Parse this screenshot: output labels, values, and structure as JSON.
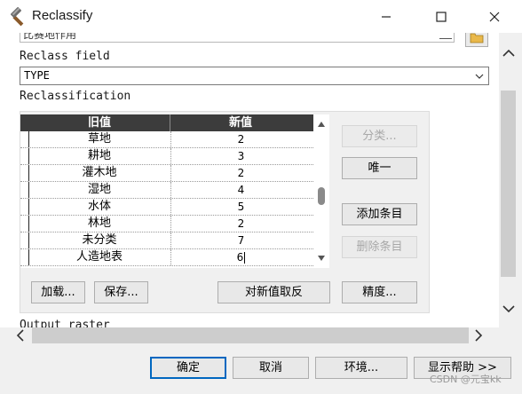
{
  "window": {
    "title": "Reclassify",
    "minimize_icon": "minimize-icon",
    "maximize_icon": "maximize-icon",
    "close_icon": "close-icon"
  },
  "input_raster": {
    "value": "比赛地作用"
  },
  "reclass_field": {
    "label": "Reclass field",
    "value": "TYPE"
  },
  "reclassification": {
    "label": "Reclassification",
    "headers": {
      "old": "旧值",
      "new": "新值"
    },
    "rows": [
      {
        "old": "草地",
        "new": "2"
      },
      {
        "old": "耕地",
        "new": "3"
      },
      {
        "old": "灌木地",
        "new": "2"
      },
      {
        "old": "湿地",
        "new": "4"
      },
      {
        "old": "水体",
        "new": "5"
      },
      {
        "old": "林地",
        "new": "2"
      },
      {
        "old": "未分类",
        "new": "7"
      },
      {
        "old": "人造地表",
        "new": "6"
      }
    ],
    "buttons": {
      "classify": "分类...",
      "unique": "唯一",
      "add_entry": "添加条目",
      "delete_entry": "删除条目",
      "load": "加载...",
      "save": "保存...",
      "reverse": "对新值取反",
      "precision": "精度..."
    }
  },
  "output_raster": {
    "label": "Output raster"
  },
  "footer": {
    "ok": "确定",
    "cancel": "取消",
    "environments": "环境...",
    "show_help": "显示帮助 >>"
  },
  "watermark": "CSDN @元宝kk",
  "colors": {
    "grid_header": "#3c3c3c",
    "default_button_border": "#0067c0",
    "dialog_background": "#f0f0f0"
  }
}
